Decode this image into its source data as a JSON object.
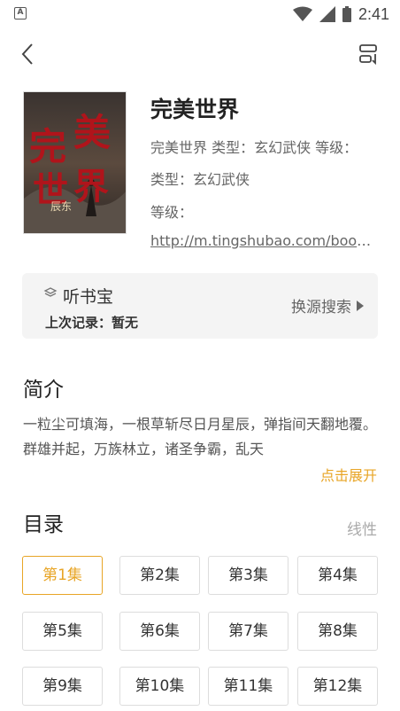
{
  "status_bar": {
    "time": "2:41",
    "app_icon_letter": "A"
  },
  "book": {
    "title": "完美世界",
    "meta_line": "完美世界 类型：玄幻武侠 等级：",
    "type_line": "类型：玄幻武侠",
    "level_line": "等级：",
    "url": "http://m.tingshubao.com/book...",
    "cover": {
      "title_chars": [
        "完",
        "美",
        "世",
        "界"
      ],
      "author": "辰东"
    }
  },
  "source": {
    "name": "听书宝",
    "last_record": "上次记录：暂无",
    "switch_label": "换源搜索"
  },
  "intro": {
    "heading": "简介",
    "text": "一粒尘可填海，一根草斩尽日月星辰，弹指间天翻地覆。群雄并起，万族林立，诸圣争霸，乱天",
    "expand_label": "点击展开"
  },
  "toc": {
    "heading": "目录",
    "mode_label": "线性",
    "episodes": [
      "第1集",
      "第2集",
      "第3集",
      "第4集",
      "第5集",
      "第6集",
      "第7集",
      "第8集",
      "第9集",
      "第10集",
      "第11集",
      "第12集"
    ],
    "selected_index": 0
  },
  "colors": {
    "accent": "#e8a526",
    "card_bg": "#f4f4f4"
  },
  "icons": {
    "back": "chevron-left-icon",
    "switch_source": "source-switch-icon",
    "source": "layers-icon",
    "arrow": "triangle-right-icon"
  }
}
